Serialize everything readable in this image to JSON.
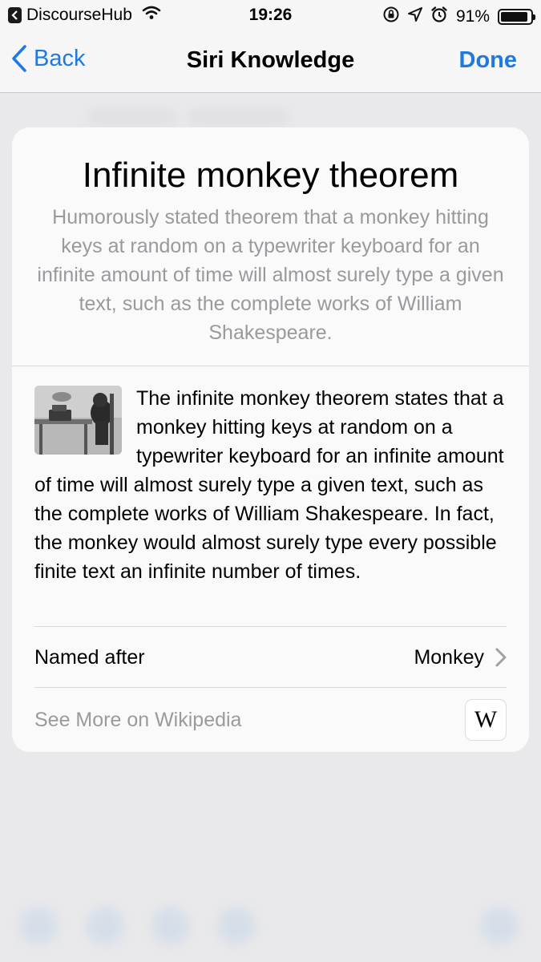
{
  "status_bar": {
    "app_name": "DiscourseHub",
    "time": "19:26",
    "battery_text": "91%",
    "battery_level": 0.91
  },
  "nav": {
    "back_label": "Back",
    "title": "Siri Knowledge",
    "done_label": "Done",
    "accent_color": "#1f7ae0"
  },
  "card": {
    "title": "Infinite monkey theorem",
    "subtitle": "Humorously stated theorem that a monkey hitting keys at random on a typewriter keyboard for an infinite amount of time will almost surely type a given text, such as the complete works of William Shakespeare.",
    "body": "The infinite monkey theorem states that a monkey hitting keys at random on a typewriter keyboard for an infinite amount of time will almost surely type a given text, such as the complete works of William Shakespeare. In fact, the monkey would almost surely type every possible finite text an infinite number of times.",
    "named_after_label": "Named after",
    "named_after_value": "Monkey",
    "wiki_link_label": "See More on Wikipedia",
    "wiki_logo_text": "W"
  }
}
